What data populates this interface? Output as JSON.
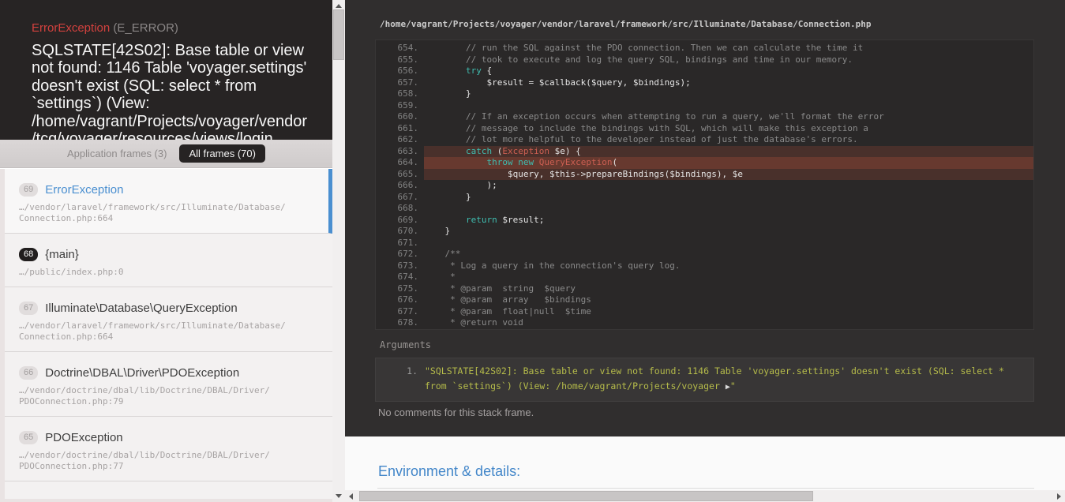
{
  "colors": {
    "accent_blue": "#4a8fd0",
    "error_red": "#d2413e",
    "keyword_teal": "#3fbdb0",
    "classname_red": "#cd5f52",
    "args_yellow": "#b5bb4a",
    "highlight_dark": "#49302b",
    "highlight_bright": "#67392f",
    "heading_blue": "#4286c9"
  },
  "left_panel": {
    "header": {
      "exception_class": "ErrorException",
      "severity": "(E_ERROR)",
      "message": "SQLSTATE[42S02]: Base table or view not found: 1146 Table 'voyager.settings' doesn't exist (SQL: select * from `settings`) (View: /home/vagrant/Projects/voyager/vendor/tcg/voyager/resources/views/login"
    },
    "tabs": [
      {
        "label": "Application frames (3)",
        "active": false
      },
      {
        "label": "All frames (70)",
        "active": true
      }
    ],
    "frames": [
      {
        "number": "69",
        "title": "ErrorException",
        "path": "…/vendor/laravel/framework/src/Illuminate/Database/Connection.php:664",
        "active": true,
        "badge_dark": false
      },
      {
        "number": "68",
        "title": "{main}",
        "path": "…/public/index.php:0",
        "active": false,
        "badge_dark": true
      },
      {
        "number": "67",
        "title": "Illuminate\\Database\\QueryException",
        "path": "…/vendor/laravel/framework/src/Illuminate/Database/Connection.php:664",
        "active": false,
        "badge_dark": false
      },
      {
        "number": "66",
        "title": "Doctrine\\DBAL\\Driver\\PDOException",
        "path": "…/vendor/doctrine/dbal/lib/Doctrine/DBAL/Driver/PDOConnection.php:79",
        "active": false,
        "badge_dark": false
      },
      {
        "number": "65",
        "title": "PDOException",
        "path": "…/vendor/doctrine/dbal/lib/Doctrine/DBAL/Driver/PDOConnection.php:77",
        "active": false,
        "badge_dark": false
      },
      {
        "number": "",
        "title": "",
        "path": "",
        "active": false,
        "badge_dark": false,
        "partial": true
      }
    ]
  },
  "right_panel": {
    "file_path": "/home/vagrant/Projects/voyager/vendor/laravel/framework/src/Illuminate/Database/Connection.php",
    "code": {
      "lines": [
        {
          "n": "654.",
          "hl": "",
          "segments": [
            {
              "c": "cm",
              "t": "        // run the SQL against the PDO connection. Then we can calculate the time it"
            }
          ]
        },
        {
          "n": "655.",
          "hl": "",
          "segments": [
            {
              "c": "cm",
              "t": "        // took to execute and log the query SQL, bindings and time in our memory."
            }
          ]
        },
        {
          "n": "656.",
          "hl": "",
          "segments": [
            {
              "c": "pl",
              "t": "        "
            },
            {
              "c": "kw",
              "t": "try"
            },
            {
              "c": "pl",
              "t": " {"
            }
          ]
        },
        {
          "n": "657.",
          "hl": "",
          "segments": [
            {
              "c": "pl",
              "t": "            $result = $callback($query, $bindings);"
            }
          ]
        },
        {
          "n": "658.",
          "hl": "",
          "segments": [
            {
              "c": "pl",
              "t": "        }"
            }
          ]
        },
        {
          "n": "659.",
          "hl": "",
          "segments": []
        },
        {
          "n": "660.",
          "hl": "",
          "segments": [
            {
              "c": "cm",
              "t": "        // If an exception occurs when attempting to run a query, we'll format the error"
            }
          ]
        },
        {
          "n": "661.",
          "hl": "",
          "segments": [
            {
              "c": "cm",
              "t": "        // message to include the bindings with SQL, which will make this exception a"
            }
          ]
        },
        {
          "n": "662.",
          "hl": "",
          "segments": [
            {
              "c": "cm",
              "t": "        // lot more helpful to the developer instead of just the database's errors."
            }
          ]
        },
        {
          "n": "663.",
          "hl": "dark",
          "segments": [
            {
              "c": "pl",
              "t": "        "
            },
            {
              "c": "kw",
              "t": "catch"
            },
            {
              "c": "pl",
              "t": " ("
            },
            {
              "c": "cls",
              "t": "Exception"
            },
            {
              "c": "pl",
              "t": " $e) {"
            }
          ]
        },
        {
          "n": "664.",
          "hl": "bright",
          "segments": [
            {
              "c": "pl",
              "t": "            "
            },
            {
              "c": "kw",
              "t": "throw"
            },
            {
              "c": "pl",
              "t": " "
            },
            {
              "c": "kw",
              "t": "new"
            },
            {
              "c": "pl",
              "t": " "
            },
            {
              "c": "cls",
              "t": "QueryException"
            },
            {
              "c": "pl",
              "t": "("
            }
          ]
        },
        {
          "n": "665.",
          "hl": "dark",
          "segments": [
            {
              "c": "pl",
              "t": "                $query, $this->prepareBindings($bindings), $e"
            }
          ]
        },
        {
          "n": "666.",
          "hl": "",
          "segments": [
            {
              "c": "pl",
              "t": "            );"
            }
          ]
        },
        {
          "n": "667.",
          "hl": "",
          "segments": [
            {
              "c": "pl",
              "t": "        }"
            }
          ]
        },
        {
          "n": "668.",
          "hl": "",
          "segments": []
        },
        {
          "n": "669.",
          "hl": "",
          "segments": [
            {
              "c": "pl",
              "t": "        "
            },
            {
              "c": "kw",
              "t": "return"
            },
            {
              "c": "pl",
              "t": " $result;"
            }
          ]
        },
        {
          "n": "670.",
          "hl": "",
          "segments": [
            {
              "c": "pl",
              "t": "    }"
            }
          ]
        },
        {
          "n": "671.",
          "hl": "",
          "segments": []
        },
        {
          "n": "672.",
          "hl": "",
          "segments": [
            {
              "c": "cm",
              "t": "    /**"
            }
          ]
        },
        {
          "n": "673.",
          "hl": "",
          "segments": [
            {
              "c": "cm",
              "t": "     * Log a query in the connection's query log."
            }
          ]
        },
        {
          "n": "674.",
          "hl": "",
          "segments": [
            {
              "c": "cm",
              "t": "     *"
            }
          ]
        },
        {
          "n": "675.",
          "hl": "",
          "segments": [
            {
              "c": "cm",
              "t": "     * @param  string  $query"
            }
          ]
        },
        {
          "n": "676.",
          "hl": "",
          "segments": [
            {
              "c": "cm",
              "t": "     * @param  array   $bindings"
            }
          ]
        },
        {
          "n": "677.",
          "hl": "",
          "segments": [
            {
              "c": "cm",
              "t": "     * @param  float|null  $time"
            }
          ]
        },
        {
          "n": "678.",
          "hl": "",
          "segments": [
            {
              "c": "cm",
              "t": "     * @return void"
            }
          ]
        }
      ]
    },
    "arguments": {
      "label": "Arguments",
      "items": [
        {
          "index": "1.",
          "text": "\"SQLSTATE[42S02]: Base table or view not found: 1146 Table 'voyager.settings' doesn't exist (SQL: select * from `settings`) (View: /home/vagrant/Projects/voyager ",
          "expander": "▶",
          "suffix": "\""
        }
      ]
    },
    "no_comments": "No comments for this stack frame.",
    "environment_heading": "Environment & details:"
  }
}
